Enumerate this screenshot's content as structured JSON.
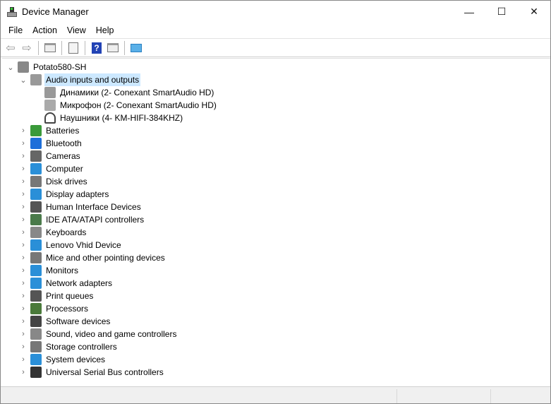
{
  "window": {
    "title": "Device Manager",
    "minimize": "—",
    "maximize": "☐",
    "close": "✕"
  },
  "menu": [
    "File",
    "Action",
    "View",
    "Help"
  ],
  "toolbar": [
    "back-icon",
    "forward-icon",
    "show-hide-console-tree-icon",
    "properties-icon",
    "help-icon",
    "action-pane-icon",
    "scan-hardware-icon"
  ],
  "tree": {
    "root": "Potato580-SH",
    "expanded": {
      "label": "Audio inputs and outputs",
      "children": [
        "Динамики (2- Conexant SmartAudio HD)",
        "Микрофон (2- Conexant SmartAudio HD)",
        "Наушники (4- KM-HIFI-384KHZ)"
      ]
    },
    "categories": [
      {
        "label": "Batteries",
        "color": "#3a9a3a"
      },
      {
        "label": "Bluetooth",
        "color": "#1e6fd9"
      },
      {
        "label": "Cameras",
        "color": "#666666"
      },
      {
        "label": "Computer",
        "color": "#2a8fd8"
      },
      {
        "label": "Disk drives",
        "color": "#777777"
      },
      {
        "label": "Display adapters",
        "color": "#2a8fd8"
      },
      {
        "label": "Human Interface Devices",
        "color": "#555555"
      },
      {
        "label": "IDE ATA/ATAPI controllers",
        "color": "#4a7a4a"
      },
      {
        "label": "Keyboards",
        "color": "#888888"
      },
      {
        "label": "Lenovo Vhid Device",
        "color": "#2a8fd8"
      },
      {
        "label": "Mice and other pointing devices",
        "color": "#777777"
      },
      {
        "label": "Monitors",
        "color": "#2a8fd8"
      },
      {
        "label": "Network adapters",
        "color": "#2a8fd8"
      },
      {
        "label": "Print queues",
        "color": "#555555"
      },
      {
        "label": "Processors",
        "color": "#4a7a3a"
      },
      {
        "label": "Software devices",
        "color": "#444444"
      },
      {
        "label": "Sound, video and game controllers",
        "color": "#888888"
      },
      {
        "label": "Storage controllers",
        "color": "#777777"
      },
      {
        "label": "System devices",
        "color": "#2a8fd8"
      },
      {
        "label": "Universal Serial Bus controllers",
        "color": "#333333"
      }
    ]
  },
  "colors": {
    "selection": "#cce8ff"
  }
}
